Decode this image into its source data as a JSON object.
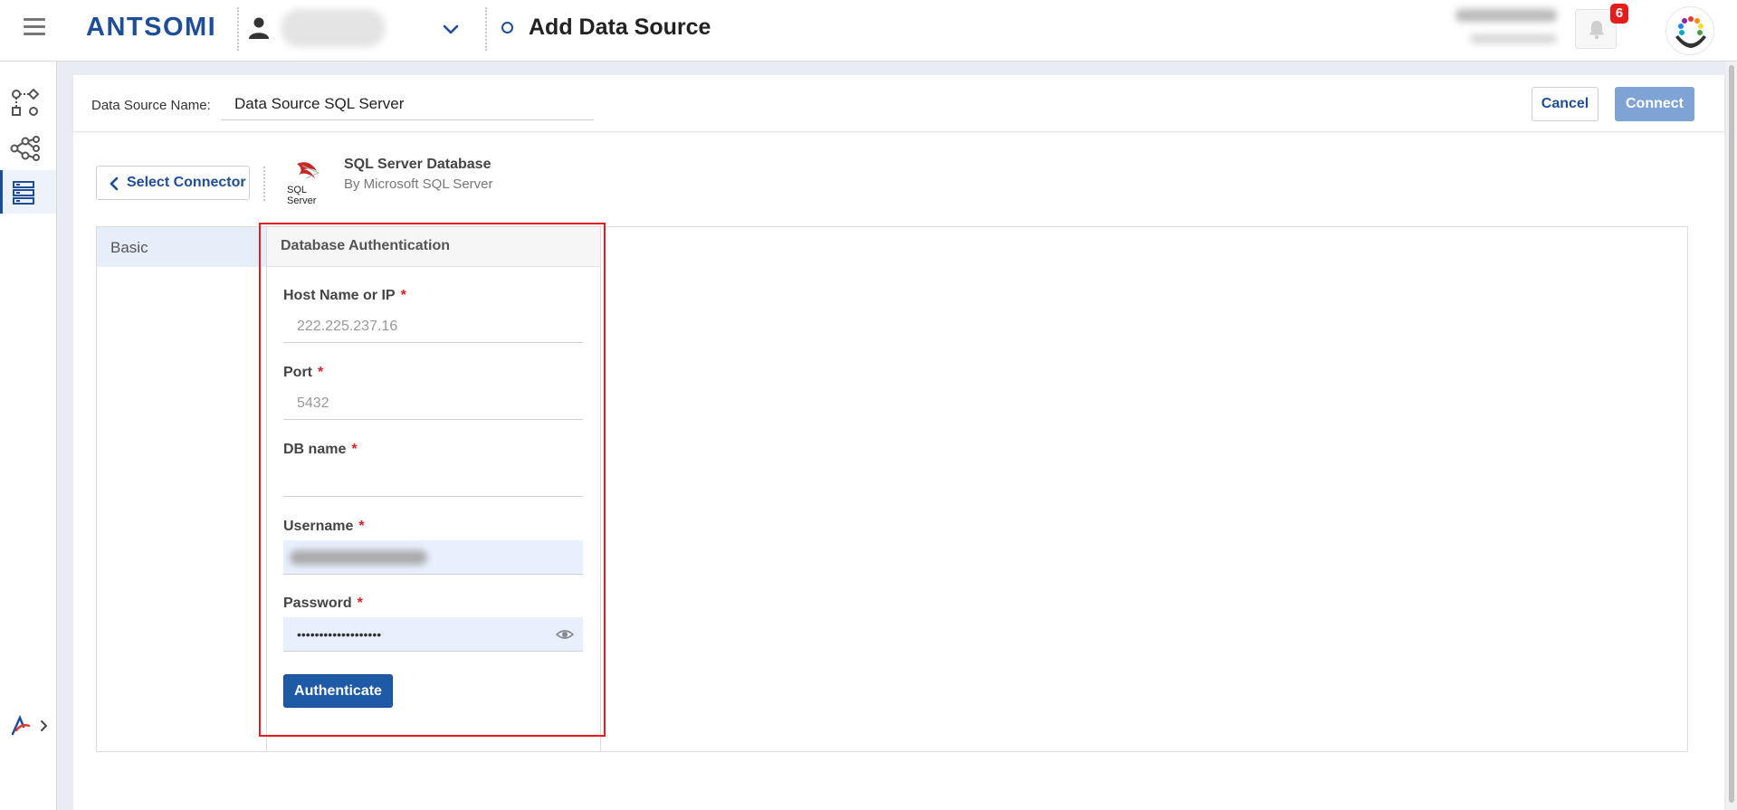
{
  "app": {
    "logo_text": "ANTSOMI",
    "page_title": "Add Data Source",
    "notification_count": "6"
  },
  "header": {
    "ds_name_label": "Data Source Name:",
    "ds_name_value": "Data Source SQL Server",
    "cancel_label": "Cancel",
    "connect_label": "Connect"
  },
  "connector": {
    "back_label": "Select Connector",
    "logo_text": "SQL Server",
    "name": "SQL Server Database",
    "vendor": "By Microsoft SQL Server"
  },
  "tabs": [
    {
      "label": "Basic",
      "active": true
    }
  ],
  "form": {
    "section_title": "Database Authentication",
    "fields": {
      "host": {
        "label": "Host Name or IP",
        "required": "*",
        "placeholder": "222.225.237.16",
        "value": ""
      },
      "port": {
        "label": "Port",
        "required": "*",
        "placeholder": "5432",
        "value": ""
      },
      "dbname": {
        "label": "DB name",
        "required": "*",
        "placeholder": "",
        "value": ""
      },
      "username": {
        "label": "Username",
        "required": "*",
        "value": ""
      },
      "password": {
        "label": "Password",
        "required": "*",
        "value": "•••••••••••••••••••"
      }
    },
    "authenticate_label": "Authenticate"
  },
  "colors": {
    "brand": "#1f4e99",
    "highlight": "#e31c24",
    "badge": "#e31c1c",
    "connect_disabled": "#7fa3d4",
    "autofill": "#e8f0fe"
  }
}
